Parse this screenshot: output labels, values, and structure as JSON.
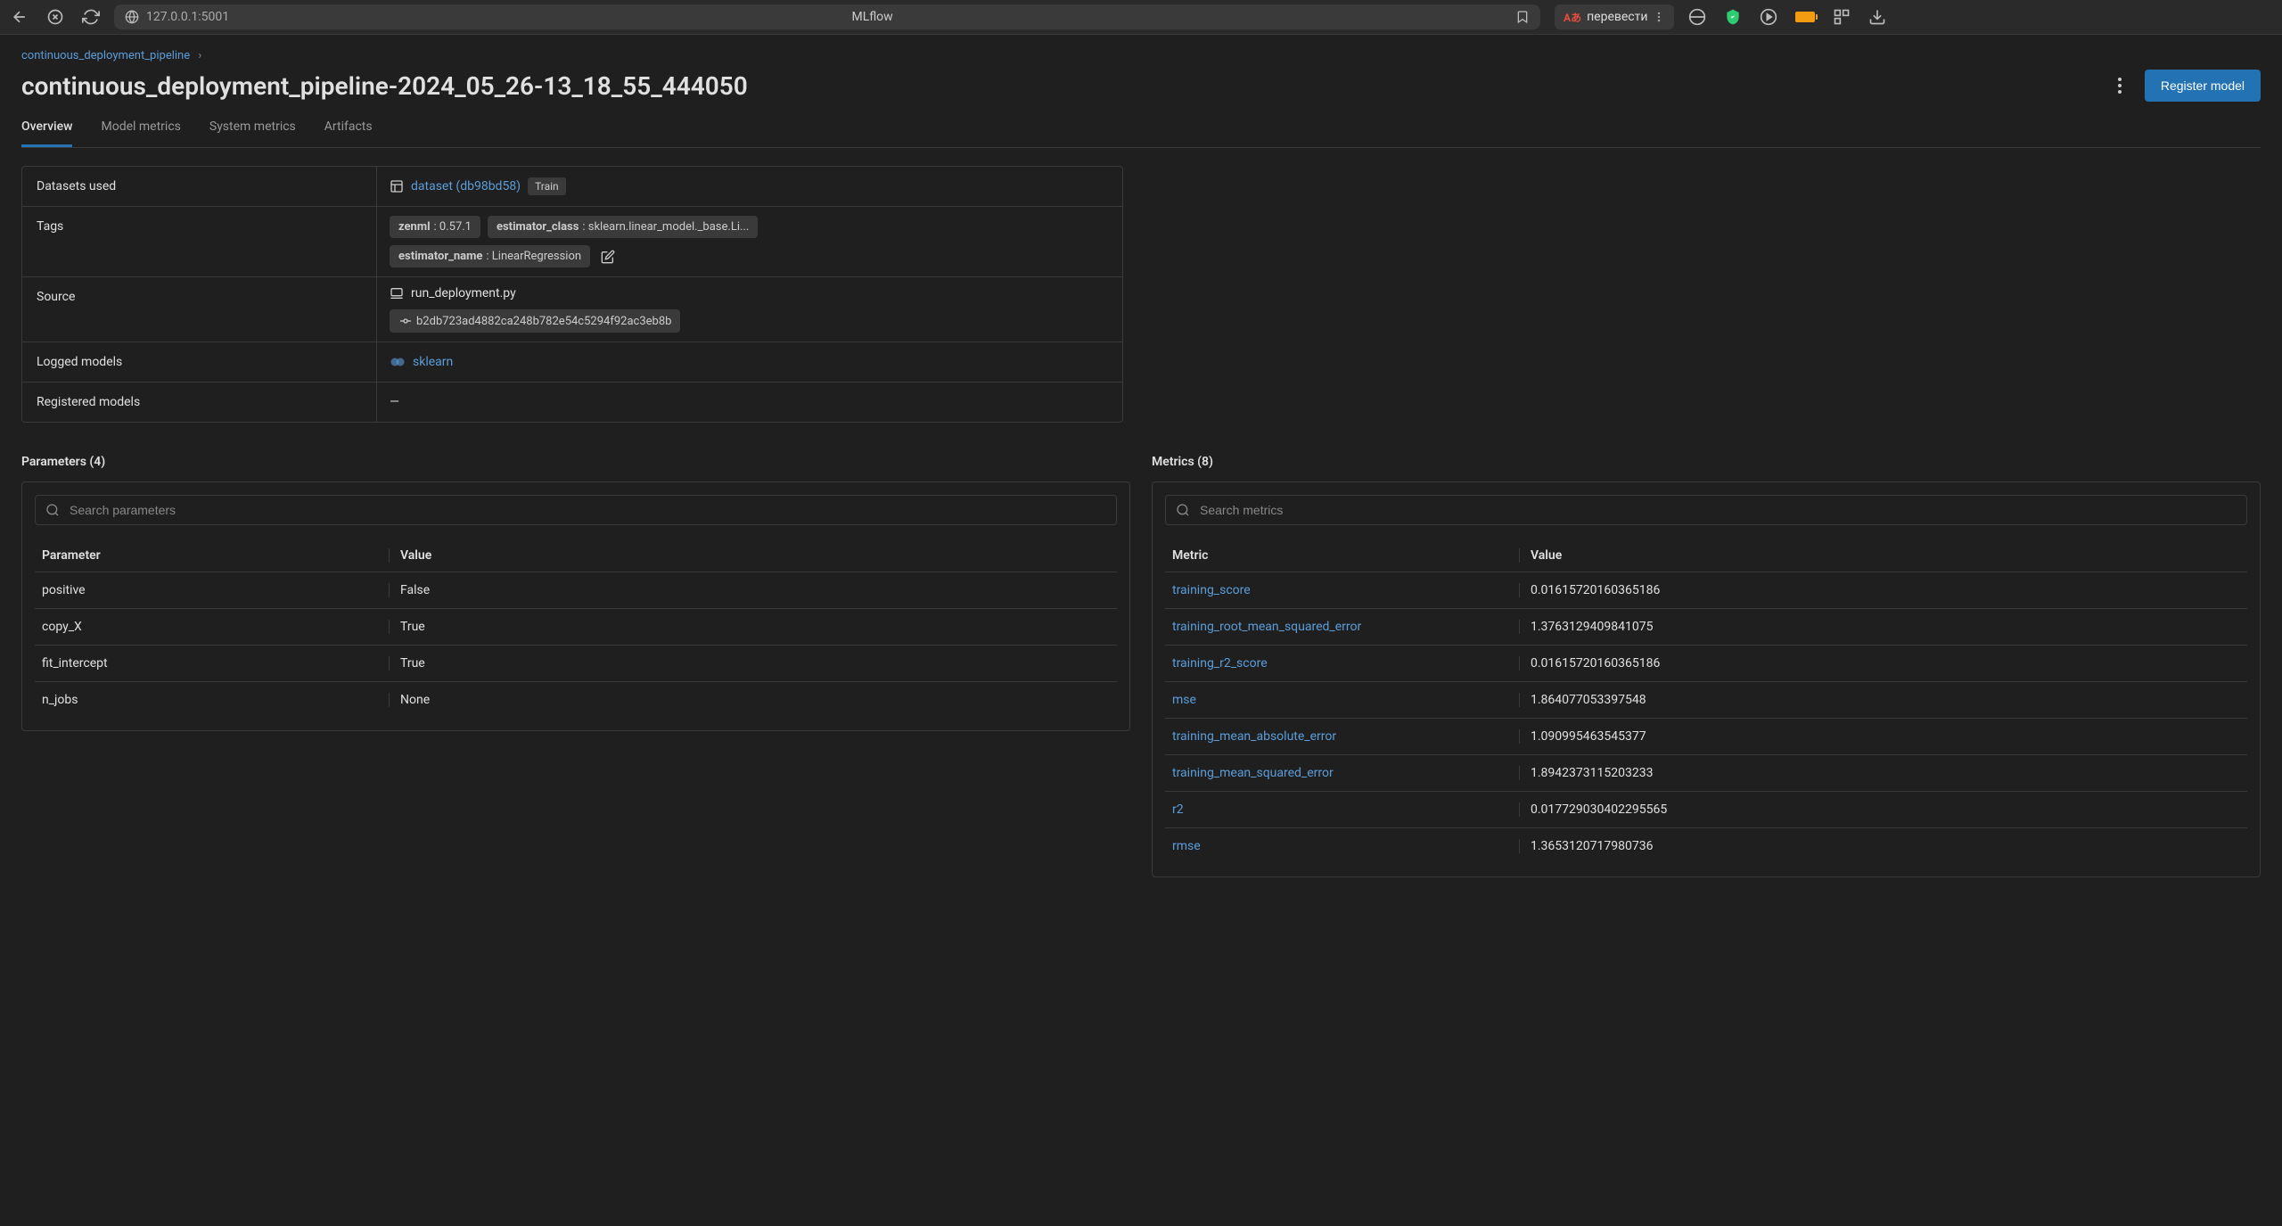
{
  "browser": {
    "url": "127.0.0.1:5001",
    "title": "MLflow",
    "translate": "перевести"
  },
  "breadcrumb": {
    "experiment": "continuous_deployment_pipeline"
  },
  "page_title": "continuous_deployment_pipeline-2024_05_26-13_18_55_444050",
  "register_button": "Register model",
  "tabs": {
    "overview": "Overview",
    "model_metrics": "Model metrics",
    "system_metrics": "System metrics",
    "artifacts": "Artifacts"
  },
  "info": {
    "datasets_label": "Datasets used",
    "dataset_name": "dataset (db98bd58)",
    "dataset_badge": "Train",
    "tags_label": "Tags",
    "tags": [
      {
        "key": "zenml",
        "value": ": 0.57.1"
      },
      {
        "key": "estimator_class",
        "value": ": sklearn.linear_model._base.Li..."
      },
      {
        "key": "estimator_name",
        "value": ": LinearRegression"
      }
    ],
    "source_label": "Source",
    "source_file": "run_deployment.py",
    "source_commit": "b2db723ad4882ca248b782e54c5294f92ac3eb8b",
    "logged_models_label": "Logged models",
    "logged_model": "sklearn",
    "registered_models_label": "Registered models",
    "registered_models_value": "—"
  },
  "parameters": {
    "title": "Parameters (4)",
    "search_placeholder": "Search parameters",
    "header_name": "Parameter",
    "header_value": "Value",
    "rows": [
      {
        "name": "positive",
        "value": "False"
      },
      {
        "name": "copy_X",
        "value": "True"
      },
      {
        "name": "fit_intercept",
        "value": "True"
      },
      {
        "name": "n_jobs",
        "value": "None"
      }
    ]
  },
  "metrics": {
    "title": "Metrics (8)",
    "search_placeholder": "Search metrics",
    "header_name": "Metric",
    "header_value": "Value",
    "rows": [
      {
        "name": "training_score",
        "value": "0.01615720160365186"
      },
      {
        "name": "training_root_mean_squared_error",
        "value": "1.3763129409841075"
      },
      {
        "name": "training_r2_score",
        "value": "0.01615720160365186"
      },
      {
        "name": "mse",
        "value": "1.864077053397548"
      },
      {
        "name": "training_mean_absolute_error",
        "value": "1.090995463545377"
      },
      {
        "name": "training_mean_squared_error",
        "value": "1.8942373115203233"
      },
      {
        "name": "r2",
        "value": "0.017729030402295565"
      },
      {
        "name": "rmse",
        "value": "1.3653120717980736"
      }
    ]
  }
}
